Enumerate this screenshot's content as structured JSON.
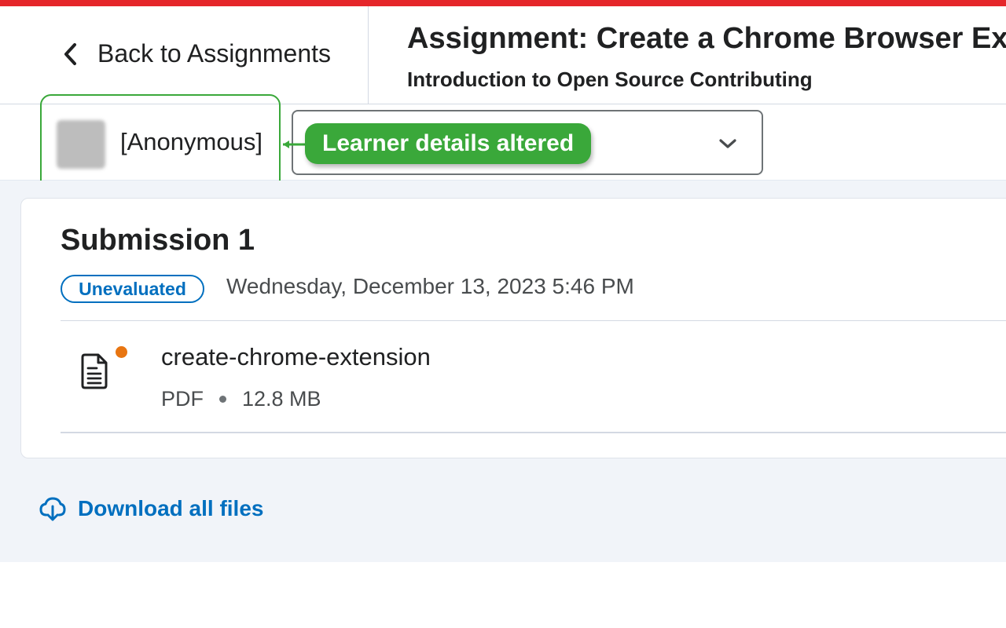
{
  "header": {
    "back_label": "Back to Assignments",
    "assignment_title": "Assignment: Create a Chrome Browser Extension",
    "course_title": "Introduction to Open Source Contributing"
  },
  "learner": {
    "name": "[Anonymous]",
    "annotation": "Learner details altered"
  },
  "submission": {
    "title": "Submission 1",
    "status": "Unevaluated",
    "date": "Wednesday, December 13, 2023 5:46 PM",
    "file": {
      "name": "create-chrome-extension",
      "type": "PDF",
      "size": "12.8 MB",
      "icon": "document-icon"
    }
  },
  "actions": {
    "download_all": "Download all files"
  },
  "colors": {
    "accent_bar": "#e5262a",
    "annotation_green": "#3aa83a",
    "link_blue": "#006fbf",
    "unread_dot": "#e87511"
  }
}
